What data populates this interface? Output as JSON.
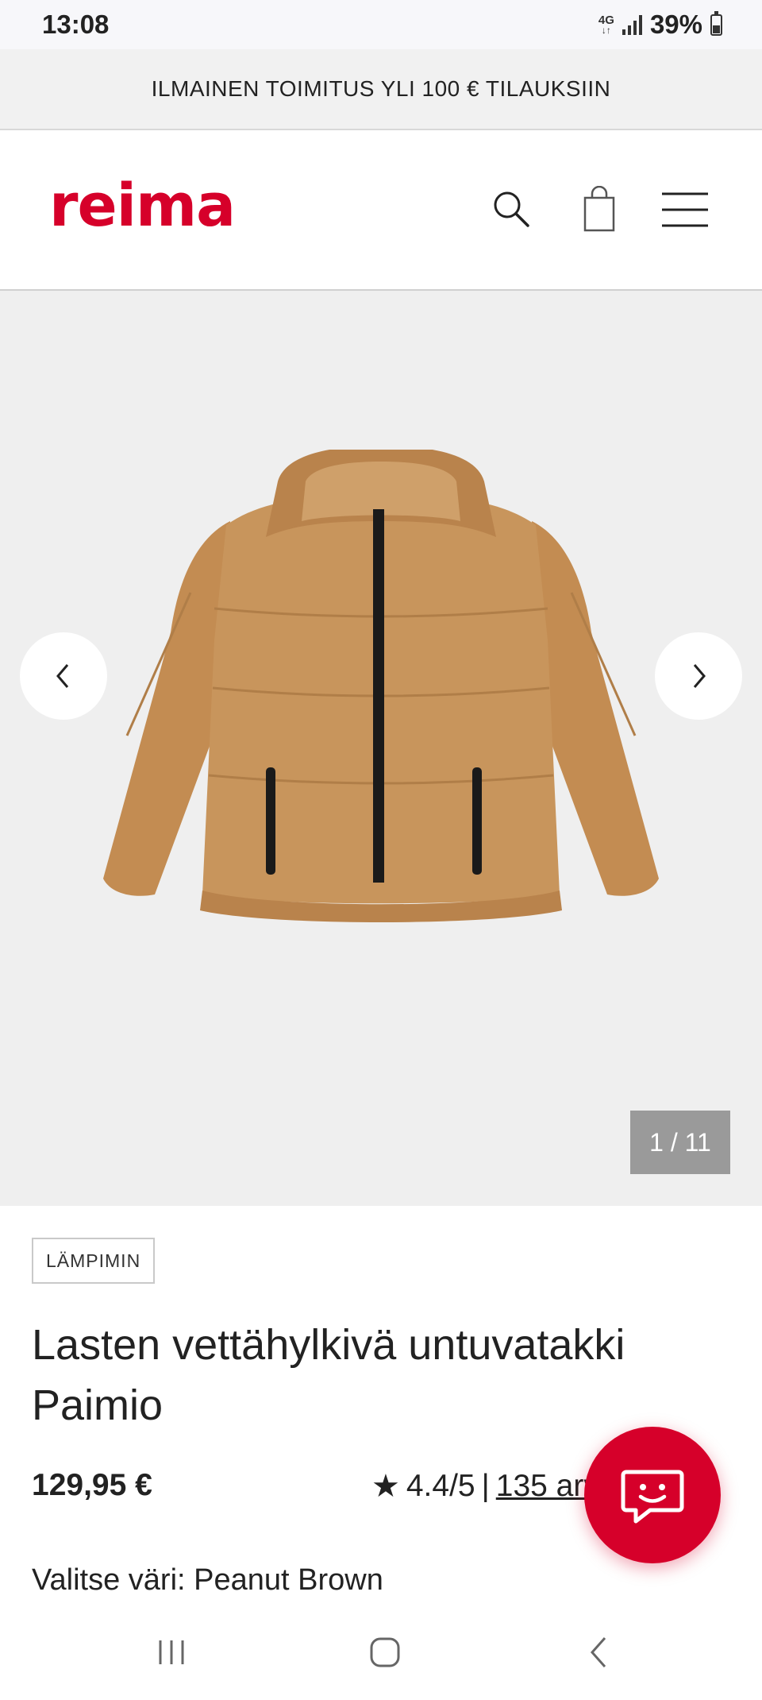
{
  "status_bar": {
    "time": "13:08",
    "network": "4G",
    "battery": "39%",
    "icons": [
      "network-4g-icon",
      "signal-icon",
      "battery-icon"
    ]
  },
  "promo_banner": {
    "text": "ILMAINEN TOIMITUS YLI 100 € TILAUKSIIN"
  },
  "header": {
    "logo": "reima",
    "icons": [
      "search-icon",
      "shopping-bag-icon",
      "hamburger-menu-icon"
    ]
  },
  "gallery": {
    "counter": "1 / 11",
    "prev_icon": "chevron-left-icon",
    "next_icon": "chevron-right-icon",
    "image": "product-jacket-image"
  },
  "product": {
    "badge": "LÄMPIMIN",
    "title": "Lasten vettähylkivä untuvatakki Paimio",
    "price": "129,95 €",
    "rating": "4.4/5",
    "separator": "|",
    "reviews": "135 arvostelua",
    "color_label": "Valitse väri: Peanut Brown"
  },
  "colors": {
    "brand": "#d6002a",
    "jacket": "#c8955c"
  },
  "chat": {
    "icon": "chat-bubble-smile-icon"
  },
  "nav_bar": {
    "icons": [
      "recent-apps-icon",
      "home-icon",
      "back-icon"
    ]
  }
}
